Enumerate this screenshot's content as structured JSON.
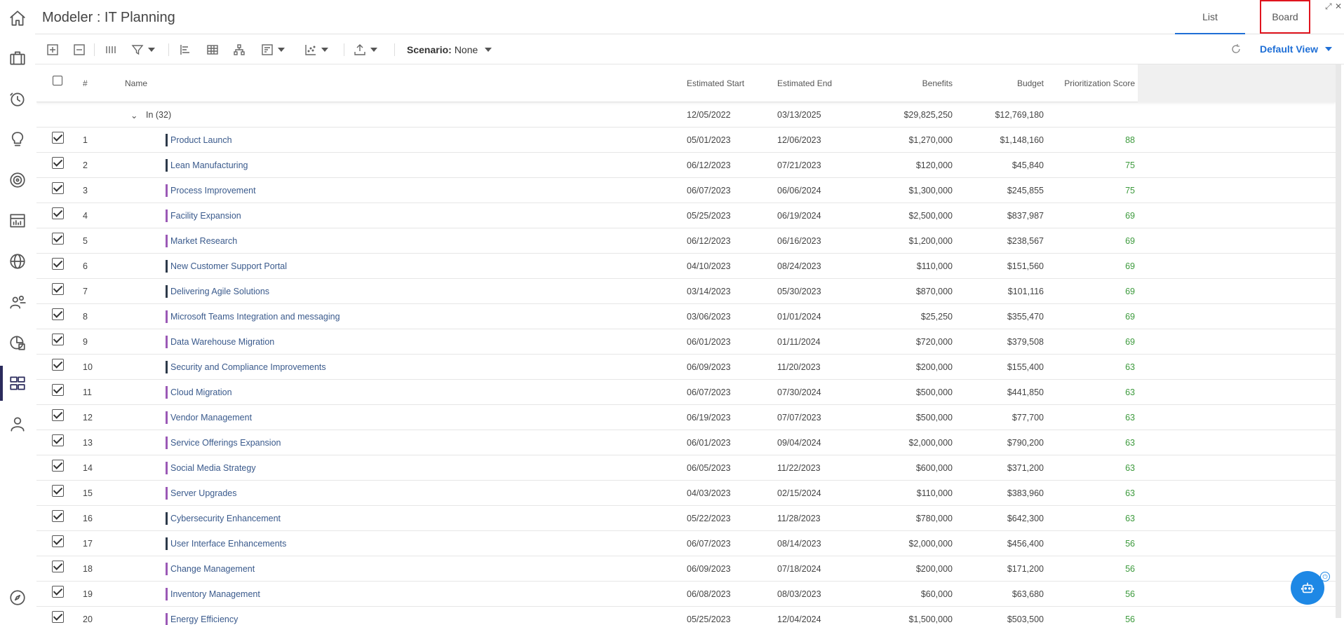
{
  "header": {
    "title": "Modeler : IT Planning",
    "tabs": [
      {
        "label": "List"
      },
      {
        "label": "Board"
      }
    ]
  },
  "toolbar": {
    "scenario_label": "Scenario:",
    "scenario_value": "None",
    "view_label": "Default View"
  },
  "grid": {
    "columns": [
      "#",
      "Name",
      "Estimated Start",
      "Estimated End",
      "Benefits",
      "Budget",
      "Prioritization Score"
    ],
    "group": {
      "label": "In (32)",
      "start": "12/05/2022",
      "end": "03/13/2025",
      "benefits": "$29,825,250",
      "budget": "$12,769,180"
    },
    "rows": [
      {
        "num": "1",
        "name": "Product Launch",
        "start": "05/01/2023",
        "end": "12/06/2023",
        "benefits": "$1,270,000",
        "budget": "$1,148,160",
        "score": "88",
        "color": "#2d3a4a"
      },
      {
        "num": "2",
        "name": "Lean Manufacturing",
        "start": "06/12/2023",
        "end": "07/21/2023",
        "benefits": "$120,000",
        "budget": "$45,840",
        "score": "75",
        "color": "#2d3a4a"
      },
      {
        "num": "3",
        "name": "Process Improvement",
        "start": "06/07/2023",
        "end": "06/06/2024",
        "benefits": "$1,300,000",
        "budget": "$245,855",
        "score": "75",
        "color": "#9b59b6"
      },
      {
        "num": "4",
        "name": "Facility Expansion",
        "start": "05/25/2023",
        "end": "06/19/2024",
        "benefits": "$2,500,000",
        "budget": "$837,987",
        "score": "69",
        "color": "#9b59b6"
      },
      {
        "num": "5",
        "name": "Market Research",
        "start": "06/12/2023",
        "end": "06/16/2023",
        "benefits": "$1,200,000",
        "budget": "$238,567",
        "score": "69",
        "color": "#9b59b6"
      },
      {
        "num": "6",
        "name": "New Customer Support Portal",
        "start": "04/10/2023",
        "end": "08/24/2023",
        "benefits": "$110,000",
        "budget": "$151,560",
        "score": "69",
        "color": "#2d3a4a"
      },
      {
        "num": "7",
        "name": "Delivering Agile Solutions",
        "start": "03/14/2023",
        "end": "05/30/2023",
        "benefits": "$870,000",
        "budget": "$101,116",
        "score": "69",
        "color": "#2d3a4a"
      },
      {
        "num": "8",
        "name": "Microsoft Teams Integration and messaging",
        "start": "03/06/2023",
        "end": "01/01/2024",
        "benefits": "$25,250",
        "budget": "$355,470",
        "score": "69",
        "color": "#9b59b6"
      },
      {
        "num": "9",
        "name": "Data Warehouse Migration",
        "start": "06/01/2023",
        "end": "01/11/2024",
        "benefits": "$720,000",
        "budget": "$379,508",
        "score": "69",
        "color": "#9b59b6"
      },
      {
        "num": "10",
        "name": "Security and Compliance Improvements",
        "start": "06/09/2023",
        "end": "11/20/2023",
        "benefits": "$200,000",
        "budget": "$155,400",
        "score": "63",
        "color": "#2d3a4a"
      },
      {
        "num": "11",
        "name": "Cloud Migration",
        "start": "06/07/2023",
        "end": "07/30/2024",
        "benefits": "$500,000",
        "budget": "$441,850",
        "score": "63",
        "color": "#9b59b6"
      },
      {
        "num": "12",
        "name": "Vendor Management",
        "start": "06/19/2023",
        "end": "07/07/2023",
        "benefits": "$500,000",
        "budget": "$77,700",
        "score": "63",
        "color": "#9b59b6"
      },
      {
        "num": "13",
        "name": "Service Offerings Expansion",
        "start": "06/01/2023",
        "end": "09/04/2024",
        "benefits": "$2,000,000",
        "budget": "$790,200",
        "score": "63",
        "color": "#9b59b6"
      },
      {
        "num": "14",
        "name": "Social Media Strategy",
        "start": "06/05/2023",
        "end": "11/22/2023",
        "benefits": "$600,000",
        "budget": "$371,200",
        "score": "63",
        "color": "#9b59b6"
      },
      {
        "num": "15",
        "name": "Server Upgrades",
        "start": "04/03/2023",
        "end": "02/15/2024",
        "benefits": "$110,000",
        "budget": "$383,960",
        "score": "63",
        "color": "#9b59b6"
      },
      {
        "num": "16",
        "name": "Cybersecurity Enhancement",
        "start": "05/22/2023",
        "end": "11/28/2023",
        "benefits": "$780,000",
        "budget": "$642,300",
        "score": "63",
        "color": "#2d3a4a"
      },
      {
        "num": "17",
        "name": "User Interface Enhancements",
        "start": "06/07/2023",
        "end": "08/14/2023",
        "benefits": "$2,000,000",
        "budget": "$456,400",
        "score": "56",
        "color": "#2d3a4a"
      },
      {
        "num": "18",
        "name": "Change Management",
        "start": "06/09/2023",
        "end": "07/18/2024",
        "benefits": "$200,000",
        "budget": "$171,200",
        "score": "56",
        "color": "#9b59b6"
      },
      {
        "num": "19",
        "name": "Inventory Management",
        "start": "06/08/2023",
        "end": "08/03/2023",
        "benefits": "$60,000",
        "budget": "$63,680",
        "score": "56",
        "color": "#9b59b6"
      },
      {
        "num": "20",
        "name": "Energy Efficiency",
        "start": "05/25/2023",
        "end": "12/04/2024",
        "benefits": "$1,500,000",
        "budget": "$503,500",
        "score": "56",
        "color": "#9b59b6"
      }
    ]
  },
  "nav_icons": [
    "home-icon",
    "briefcase-icon",
    "clock-icon",
    "lightbulb-icon",
    "target-icon",
    "chart-icon",
    "globe-icon",
    "people-icon",
    "reports-icon",
    "modeler-icon",
    "user-icon",
    "compass-icon"
  ],
  "colors": {
    "accent": "#1f6fd6",
    "score": "#3c9a3c",
    "highlight": "#e0141e"
  }
}
